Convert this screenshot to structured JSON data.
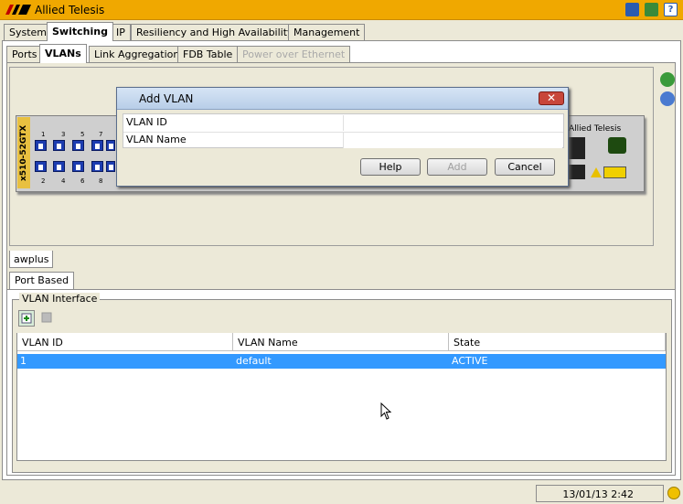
{
  "app": {
    "title": "Allied Telesis"
  },
  "tabs_main": [
    {
      "label": "System"
    },
    {
      "label": "Switching"
    },
    {
      "label": "IP"
    },
    {
      "label": "Resiliency and High Availability"
    },
    {
      "label": "Management"
    }
  ],
  "tabs_sub": [
    {
      "label": "Ports"
    },
    {
      "label": "VLANs"
    },
    {
      "label": "Link Aggregation"
    },
    {
      "label": "FDB Table"
    },
    {
      "label": "Power over Ethernet"
    }
  ],
  "device": {
    "model": "x510-52GTX",
    "brand": "Allied Telesis",
    "port_top_numbers": [
      "1",
      "3",
      "5",
      "7"
    ],
    "port_bottom_numbers": [
      "2",
      "4",
      "6",
      "8"
    ]
  },
  "host_tab": "awplus",
  "vlan_tab": "Port Based",
  "vlan_interface": {
    "title": "VLAN Interface",
    "columns": [
      "VLAN ID",
      "VLAN Name",
      "State"
    ],
    "rows": [
      {
        "id": "1",
        "name": "default",
        "state": "ACTIVE"
      }
    ]
  },
  "status": {
    "datetime": "13/01/13 2:42"
  },
  "dialog": {
    "title": "Add VLAN",
    "fields": [
      {
        "label": "VLAN ID",
        "value": ""
      },
      {
        "label": "VLAN Name",
        "value": ""
      }
    ],
    "buttons": {
      "help": "Help",
      "add": "Add",
      "cancel": "Cancel"
    }
  },
  "colors": {
    "titlebar": "#f0a800",
    "selected_row": "#3399ff",
    "port": "#1c3cb0"
  }
}
